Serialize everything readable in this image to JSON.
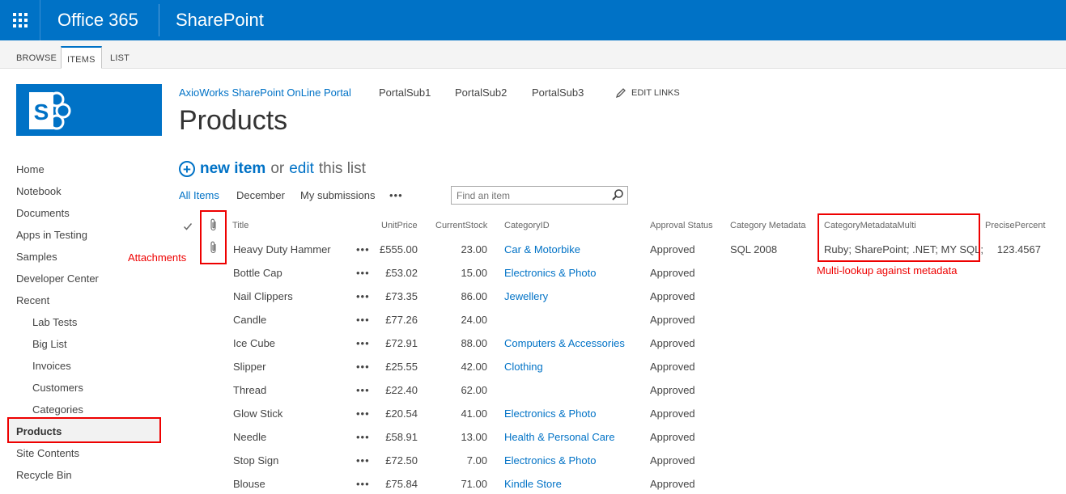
{
  "suite": {
    "brand": "Office 365",
    "app": "SharePoint"
  },
  "ribbon": {
    "tabs": [
      "BROWSE",
      "ITEMS",
      "LIST"
    ],
    "active": "ITEMS"
  },
  "topnav": {
    "site": "AxioWorks SharePoint OnLine Portal",
    "links": [
      "PortalSub1",
      "PortalSub2",
      "PortalSub3"
    ],
    "edit_links": "EDIT LINKS"
  },
  "page": {
    "title": "Products"
  },
  "leftnav": [
    "Home",
    "Notebook",
    "Documents",
    "Apps in Testing",
    "Samples",
    "Developer Center",
    "Recent",
    "Lab Tests",
    "Big List",
    "Invoices",
    "Customers",
    "Categories",
    "Products",
    "Site Contents",
    "Recycle Bin"
  ],
  "actions": {
    "new_item": "new item",
    "or": "or",
    "edit": "edit",
    "this_list": "this list"
  },
  "views": {
    "items": [
      "All Items",
      "December",
      "My submissions"
    ],
    "ellipsis": "•••",
    "search_placeholder": "Find an item"
  },
  "table": {
    "headers": [
      "Title",
      "UnitPrice",
      "CurrentStock",
      "CategoryID",
      "Approval Status",
      "Category Metadata",
      "CategoryMetadataMulti",
      "PrecisePercent"
    ],
    "rows": [
      {
        "title": "Heavy Duty Hammer",
        "price": "£555.00",
        "stock": "23.00",
        "category": "Car & Motorbike",
        "status": "Approved",
        "meta": "SQL 2008",
        "multi": "Ruby; SharePoint; .NET; MY SQL;",
        "percent": "123.4567",
        "attach": true
      },
      {
        "title": "Bottle Cap",
        "price": "£53.02",
        "stock": "15.00",
        "category": "Electronics & Photo",
        "status": "Approved",
        "meta": "",
        "multi": "",
        "percent": "",
        "attach": false
      },
      {
        "title": "Nail Clippers",
        "price": "£73.35",
        "stock": "86.00",
        "category": "Jewellery",
        "status": "Approved",
        "meta": "",
        "multi": "",
        "percent": "",
        "attach": false
      },
      {
        "title": "Candle",
        "price": "£77.26",
        "stock": "24.00",
        "category": "",
        "status": "Approved",
        "meta": "",
        "multi": "",
        "percent": "",
        "attach": false
      },
      {
        "title": "Ice Cube",
        "price": "£72.91",
        "stock": "88.00",
        "category": "Computers & Accessories",
        "status": "Approved",
        "meta": "",
        "multi": "",
        "percent": "",
        "attach": false
      },
      {
        "title": "Slipper",
        "price": "£25.55",
        "stock": "42.00",
        "category": "Clothing",
        "status": "Approved",
        "meta": "",
        "multi": "",
        "percent": "",
        "attach": false
      },
      {
        "title": "Thread",
        "price": "£22.40",
        "stock": "62.00",
        "category": "",
        "status": "Approved",
        "meta": "",
        "multi": "",
        "percent": "",
        "attach": false
      },
      {
        "title": "Glow Stick",
        "price": "£20.54",
        "stock": "41.00",
        "category": "Electronics & Photo",
        "status": "Approved",
        "meta": "",
        "multi": "",
        "percent": "",
        "attach": false
      },
      {
        "title": "Needle",
        "price": "£58.91",
        "stock": "13.00",
        "category": "Health & Personal Care",
        "status": "Approved",
        "meta": "",
        "multi": "",
        "percent": "",
        "attach": false
      },
      {
        "title": "Stop Sign",
        "price": "£72.50",
        "stock": "7.00",
        "category": "Electronics & Photo",
        "status": "Approved",
        "meta": "",
        "multi": "",
        "percent": "",
        "attach": false
      },
      {
        "title": "Blouse",
        "price": "£75.84",
        "stock": "71.00",
        "category": "Kindle Store",
        "status": "Approved",
        "meta": "",
        "multi": "",
        "percent": "",
        "attach": false
      }
    ]
  },
  "annotations": {
    "attachments": "Attachments",
    "multi": "Multi-lookup against metadata"
  },
  "colors": {
    "suite": "#0072c6",
    "link": "#0072c6",
    "annotation": "#ee0000"
  },
  "icons": [
    "app-launcher-icon",
    "sharepoint-logo-icon",
    "pencil-icon",
    "plus-circle-icon",
    "search-icon",
    "checkmark-icon",
    "paperclip-icon"
  ]
}
